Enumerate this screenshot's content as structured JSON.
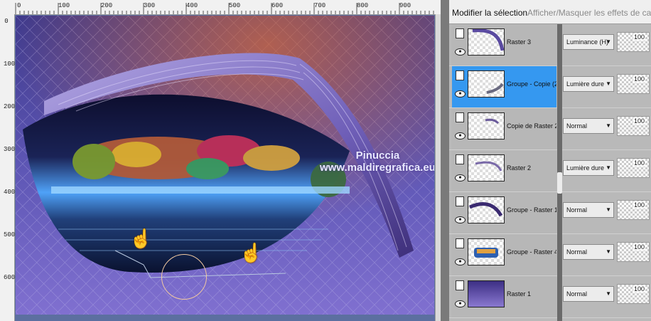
{
  "ruler": {
    "top_labels": [
      "0",
      "100",
      "200",
      "300",
      "400",
      "500",
      "600",
      "700",
      "800",
      "900"
    ],
    "left_labels": [
      "0",
      "100",
      "200",
      "300",
      "400",
      "500",
      "600"
    ]
  },
  "canvas": {
    "watermark_line1": "Pinuccia",
    "watermark_line2": "www.maldiregrafica.eu"
  },
  "panel": {
    "header_action": "Modifier la sélection",
    "header_hint": "Afficher/Masquer les effets de calque"
  },
  "layers": [
    {
      "name": "Raster 3",
      "blend": "Luminance (H)",
      "opacity": "100",
      "selected": false
    },
    {
      "name": "Groupe - Copie (2)",
      "blend": "Lumière dure",
      "opacity": "100",
      "selected": true
    },
    {
      "name": "Copie de Raster 2",
      "blend": "Normal",
      "opacity": "100",
      "selected": false
    },
    {
      "name": "Raster 2",
      "blend": "Lumière dure",
      "opacity": "100",
      "selected": false
    },
    {
      "name": "Groupe - Raster 1",
      "blend": "Normal",
      "opacity": "100",
      "selected": false
    },
    {
      "name": "Groupe - Raster 4",
      "blend": "Normal",
      "opacity": "100",
      "selected": false
    },
    {
      "name": "Raster 1",
      "blend": "Normal",
      "opacity": "100",
      "selected": false
    }
  ],
  "colors": {
    "selection": "#3598f0",
    "panel_bg": "#b9b9b9"
  }
}
